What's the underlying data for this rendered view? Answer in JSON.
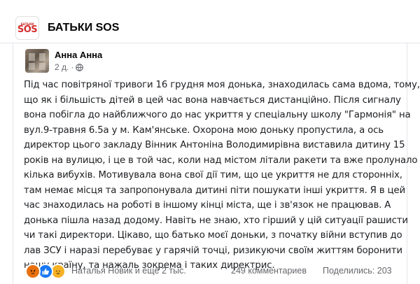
{
  "header": {
    "logo_top": "БАТЬКИ",
    "logo_main": "SOS",
    "title": "БАТЬКИ SOS"
  },
  "post": {
    "author": "Анна Анна",
    "time": "2 д.",
    "separator": "·",
    "lines": [
      "Під час повітряної тривоги 16 грудня моя донька, знаходилась сама вдома, тому,",
      "що як і більшість дітей в цей час вона  навчається дистанційно. Після сигналу",
      "вона побігла до найближчого до нас укриття у спеціальну школу \"Гармонія\" на",
      "вул.9-травня 6.5а у м. Кам'янське. Охорона мою доньку пропустила, а ось",
      "директор цього закладу Вінник Антоніна Володимирівна виставила дитину 15",
      "років на вулицю, і це в той час, коли над містом літали ракети та вже пролунало",
      "кілька вибухів. Мотивувала вона свої дії тим, що це укриття не для сторонніх,",
      "там немає місця та запропонувала дитині піти пошукати інші укриття.  Я в цей",
      "час знаходилась на роботі в іншому кінці міста, ще і зв'язок не працював. А",
      "донька пішла назад додому. Навіть не знаю, хто гірший у цій ситуації рашисти",
      "чи такі директори. Цікаво, що батько моєї доньки, з початку війни вступив до",
      "лав ЗСУ і наразі перебуває у гарячій точці, ризикуючи своїм життям боронити",
      "нашу країну, та нажаль зокрема і таких директрис."
    ]
  },
  "footer": {
    "reactors": "Наталья Новик и ещё 2 тыс.",
    "comments": "249 комментариев",
    "shares": "Поделились: 203",
    "reaction_icons": [
      "angry-reaction-icon",
      "like-reaction-icon",
      "sad-reaction-icon"
    ]
  },
  "colors": {
    "accent_blue": "#1877f2",
    "secondary_text": "#65676b",
    "logo_red": "#d32f2f"
  }
}
